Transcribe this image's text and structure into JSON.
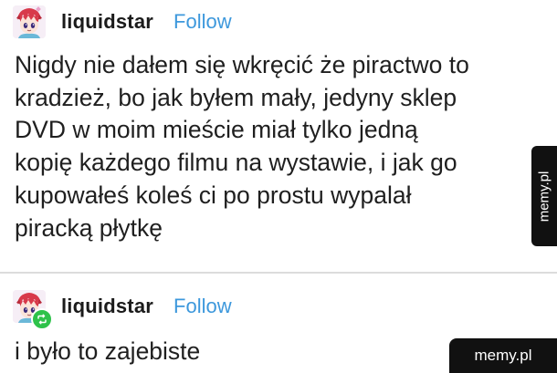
{
  "posts": [
    {
      "username": "liquidstar",
      "follow_label": "Follow",
      "avatar_icon": "anime-avatar-icon",
      "body_lines": [
        "Nigdy nie dałem się wkręcić że piractwo to",
        "kradzież, bo jak byłem mały, jedyny sklep",
        "DVD w moim mieście miał tylko jedną",
        "kopię każdego filmu na wystawie, i jak go",
        "kupowałeś koleś ci po prostu wypalał",
        "piracką płytkę"
      ]
    },
    {
      "username": "liquidstar",
      "follow_label": "Follow",
      "avatar_icon": "anime-avatar-icon",
      "badge_icon": "reblog-icon",
      "body": "i było to zajebiste"
    }
  ],
  "watermarks": {
    "side": "memy.pl",
    "corner": "memy.pl"
  },
  "colors": {
    "follow": "#3d98dc",
    "reblog_badge": "#2ec24a",
    "watermark_bg": "#111111"
  }
}
